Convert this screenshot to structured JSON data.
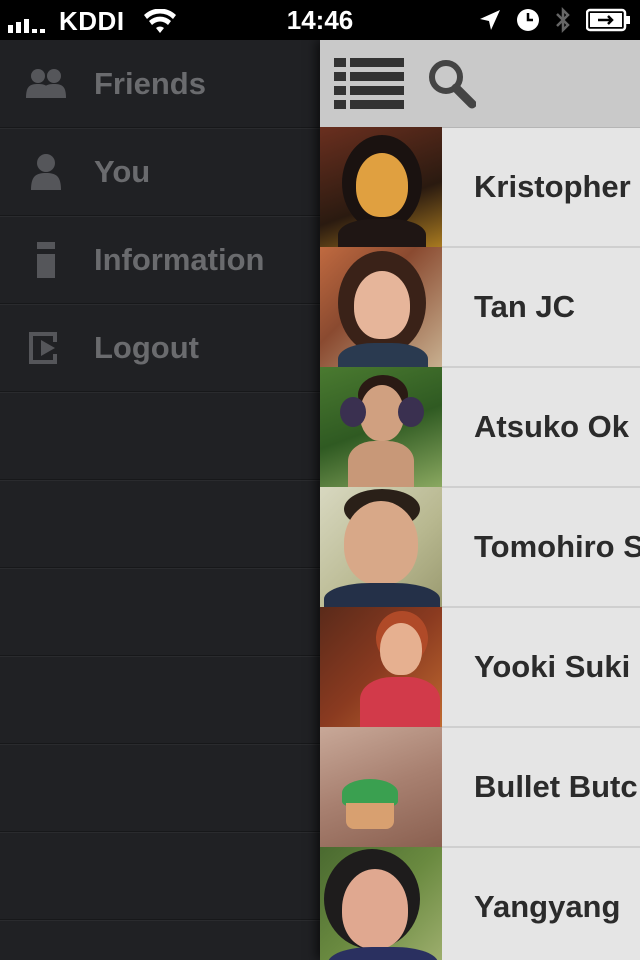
{
  "status_bar": {
    "carrier": "KDDI",
    "time": "14:46"
  },
  "sidebar": {
    "items": [
      {
        "label": "Friends",
        "icon": "friends-icon"
      },
      {
        "label": "You",
        "icon": "user-icon"
      },
      {
        "label": "Information",
        "icon": "info-icon"
      },
      {
        "label": "Logout",
        "icon": "logout-icon"
      }
    ],
    "bg_color": "#202124"
  },
  "toolbar": {
    "list_icon": "list-icon",
    "search_icon": "search-icon"
  },
  "friends": [
    {
      "name": "Kristopher"
    },
    {
      "name": "Tan JC"
    },
    {
      "name": "Atsuko Ok"
    },
    {
      "name": "Tomohiro S"
    },
    {
      "name": "Yooki Suki"
    },
    {
      "name": "Bullet Butc"
    },
    {
      "name": "Yangyang"
    }
  ]
}
